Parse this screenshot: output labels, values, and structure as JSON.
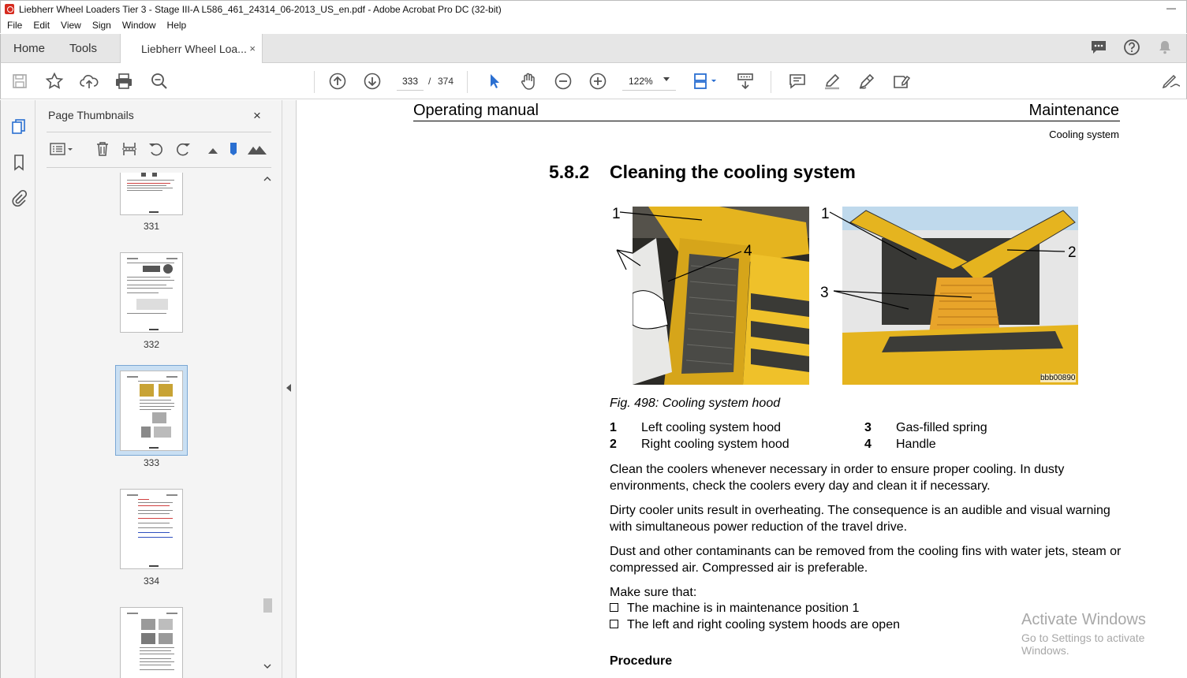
{
  "window": {
    "title": "Liebherr Wheel Loaders Tier 3 - Stage III-A L586_461_24314_06-2013_US_en.pdf - Adobe Acrobat Pro DC (32-bit)",
    "minimize": "—"
  },
  "menu": [
    "File",
    "Edit",
    "View",
    "Sign",
    "Window",
    "Help"
  ],
  "tabs": {
    "home": "Home",
    "tools": "Tools",
    "document": "Liebherr Wheel Loa...",
    "close": "×"
  },
  "toolbar": {
    "current_page": "333",
    "page_separator": "/",
    "total_pages": "374",
    "zoom": "122%"
  },
  "thumbnails": {
    "title": "Page Thumbnails",
    "close": "×",
    "pages": [
      "331",
      "332",
      "333",
      "334"
    ],
    "selected_page": "333"
  },
  "document": {
    "header_left": "Operating manual",
    "header_right": "Maintenance",
    "subsection": "Cooling system",
    "section_number": "5.8.2",
    "section_title": "Cleaning the cooling system",
    "figure_labels": {
      "left_1": "1",
      "left_4": "4",
      "right_1": "1",
      "right_2": "2",
      "right_3": "3"
    },
    "figure_code": "bbb00890",
    "figure_caption": "Fig. 498: Cooling system hood",
    "legend": [
      {
        "num": "1",
        "text": "Left cooling system hood"
      },
      {
        "num": "2",
        "text": "Right cooling system hood"
      },
      {
        "num": "3",
        "text": "Gas-filled spring"
      },
      {
        "num": "4",
        "text": "Handle"
      }
    ],
    "paragraphs": [
      "Clean the coolers whenever necessary in order to ensure proper cooling. In dusty environments, check the coolers every day and clean it if necessary.",
      "Dirty cooler units result in overheating. The consequence is an audible and visual warning with simultaneous power reduction of the travel drive.",
      "Dust and other contaminants can be removed from the cooling fins with water jets, steam or compressed air. Compressed air is preferable.",
      "Make sure that:"
    ],
    "checklist": [
      "The machine is in maintenance position 1",
      "The left and right cooling system hoods are open"
    ],
    "procedure_heading": "Procedure"
  },
  "watermark": {
    "line1": "Activate Windows",
    "line2": "Go to Settings to activate Windows."
  }
}
